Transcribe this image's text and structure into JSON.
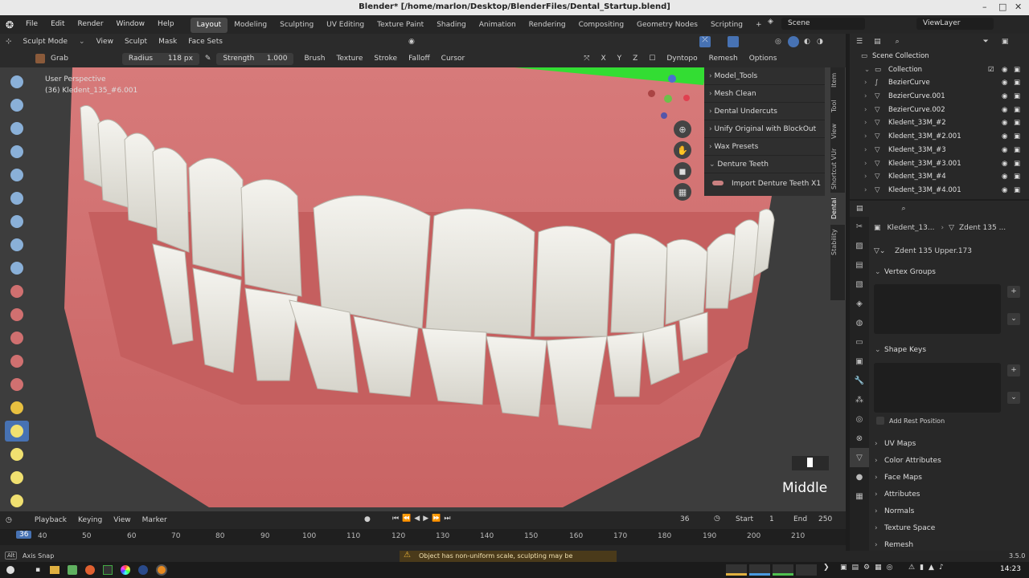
{
  "window": {
    "title": "Blender* [/home/marlon/Desktop/BlenderFiles/Dental_Startup.blend]"
  },
  "menu": [
    "File",
    "Edit",
    "Render",
    "Window",
    "Help"
  ],
  "workspaces": [
    "Layout",
    "Modeling",
    "Sculpting",
    "UV Editing",
    "Texture Paint",
    "Shading",
    "Animation",
    "Rendering",
    "Compositing",
    "Geometry Nodes",
    "Scripting"
  ],
  "active_workspace": "Layout",
  "scene": {
    "label": "Scene",
    "viewlayer": "ViewLayer"
  },
  "header1": {
    "mode": "Sculpt Mode",
    "items": [
      "View",
      "Sculpt",
      "Mask",
      "Face Sets"
    ]
  },
  "header2": {
    "tool": "Grab",
    "radius_label": "Radius",
    "radius_value": "118 px",
    "strength_label": "Strength",
    "strength_value": "1.000",
    "menus": [
      "Brush",
      "Texture",
      "Stroke",
      "Falloff",
      "Cursor"
    ],
    "axes": [
      "X",
      "Y",
      "Z"
    ],
    "dyntopo": "Dyntopo",
    "remesh": "Remesh",
    "options": "Options"
  },
  "overlay": {
    "perspective": "User Perspective",
    "object": "(36) Kledent_135_#6.001"
  },
  "npanel": {
    "items": [
      "Model_Tools",
      "Mesh Clean",
      "Dental Undercuts",
      "Unify Original with BlockOut",
      "Wax Presets",
      "Denture Teeth"
    ],
    "import_btn": "Import Denture Teeth X1"
  },
  "ntabs": [
    "Item",
    "Tool",
    "View",
    "Shortcut VUr",
    "Dental",
    "Stability"
  ],
  "key_overlay": "Middle",
  "timeline": {
    "menus": [
      "Playback",
      "Keying",
      "View",
      "Marker"
    ],
    "current": "36",
    "start_label": "Start",
    "start": "1",
    "end_label": "End",
    "end": "250",
    "ticks": [
      "36",
      "40",
      "50",
      "60",
      "70",
      "80",
      "90",
      "100",
      "110",
      "120",
      "130",
      "140",
      "150",
      "160",
      "170",
      "180",
      "190",
      "200",
      "210"
    ]
  },
  "status": {
    "left": "Axis Snap",
    "warning": "Object has non-uniform scale, sculpting may be unpredictable",
    "version": "3.5.0"
  },
  "clock": "14:23",
  "outliner": {
    "root": "Scene Collection",
    "items": [
      {
        "name": "Collection",
        "icon": "collection-icon"
      },
      {
        "name": "BezierCurve",
        "icon": "curve-icon"
      },
      {
        "name": "BezierCurve.001",
        "icon": "curve-icon"
      },
      {
        "name": "BezierCurve.002",
        "icon": "curve-icon"
      },
      {
        "name": "Kledent_33M_#2",
        "icon": "mesh-icon"
      },
      {
        "name": "Kledent_33M_#2.001",
        "icon": "mesh-icon"
      },
      {
        "name": "Kledent_33M_#3",
        "icon": "mesh-icon"
      },
      {
        "name": "Kledent_33M_#3.001",
        "icon": "mesh-icon"
      },
      {
        "name": "Kledent_33M_#4",
        "icon": "mesh-icon"
      },
      {
        "name": "Kledent_33M_#4.001",
        "icon": "mesh-icon"
      }
    ]
  },
  "properties": {
    "breadcrumb_obj": "Kledent_13...",
    "breadcrumb_mesh": "Zdent 135 ...",
    "mesh_name": "Zdent 135 Upper.173",
    "sections": [
      "Vertex Groups",
      "Shape Keys",
      "UV Maps",
      "Color Attributes",
      "Face Maps",
      "Attributes",
      "Normals",
      "Texture Space",
      "Remesh"
    ],
    "add_rest": "Add Rest Position"
  },
  "colors": {
    "accent": "#4772b3",
    "gum": "#d87575",
    "teeth": "#ecebe4",
    "warning": "#e8b33a"
  }
}
